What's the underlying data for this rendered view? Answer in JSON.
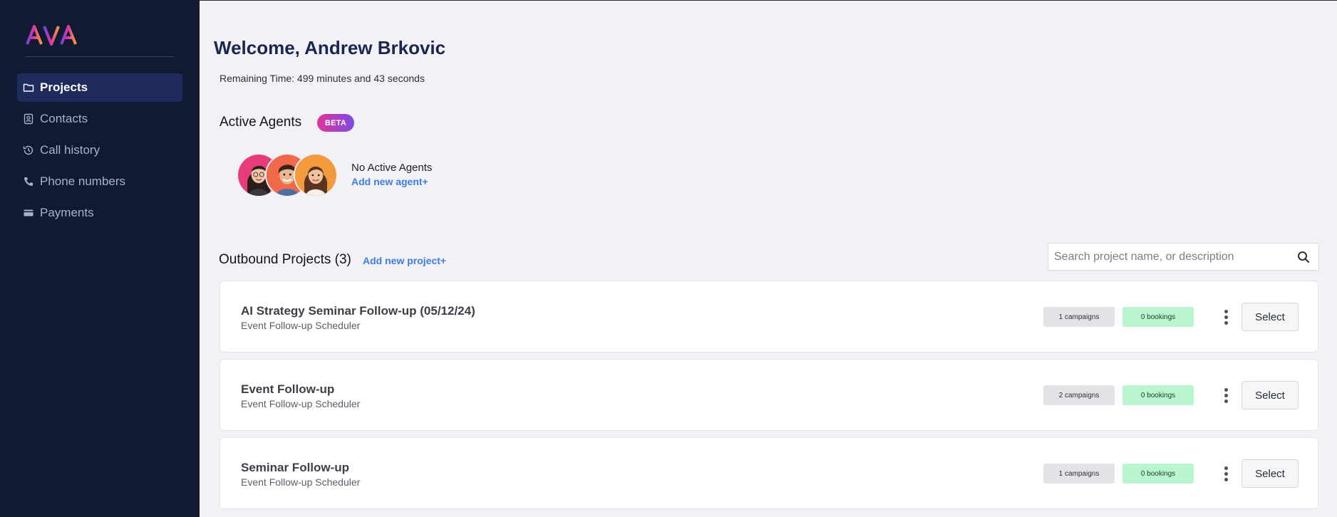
{
  "sidebar": {
    "logo_text": "AVA",
    "items": [
      {
        "label": "Projects",
        "icon": "folder-icon",
        "active": true
      },
      {
        "label": "Contacts",
        "icon": "contact-card-icon",
        "active": false
      },
      {
        "label": "Call history",
        "icon": "history-icon",
        "active": false
      },
      {
        "label": "Phone numbers",
        "icon": "phone-icon",
        "active": false
      },
      {
        "label": "Payments",
        "icon": "credit-card-icon",
        "active": false
      }
    ]
  },
  "header": {
    "welcome": "Welcome, Andrew Brkovic",
    "remaining_time": "Remaining Time: 499 minutes and 43 seconds"
  },
  "agents": {
    "title": "Active Agents",
    "badge": "BETA",
    "status": "No Active Agents",
    "add_link": "Add new agent+"
  },
  "projects": {
    "title": "Outbound Projects (3)",
    "add_link": "Add new project+",
    "search_placeholder": "Search project name, or description",
    "items": [
      {
        "title": "AI Strategy Seminar Follow-up (05/12/24)",
        "subtitle": "Event Follow-up Scheduler",
        "campaigns": "1 campaigns",
        "bookings": "0 bookings",
        "select_label": "Select"
      },
      {
        "title": "Event Follow-up",
        "subtitle": "Event Follow-up Scheduler",
        "campaigns": "2 campaigns",
        "bookings": "0 bookings",
        "select_label": "Select"
      },
      {
        "title": "Seminar Follow-up",
        "subtitle": "Event Follow-up Scheduler",
        "campaigns": "1 campaigns",
        "bookings": "0 bookings",
        "select_label": "Select"
      }
    ]
  },
  "colors": {
    "sidebar_bg": "#111a33",
    "active_nav": "#1f2b5c",
    "link": "#3d7de0",
    "bookings_badge": "#b9f5cf",
    "campaigns_badge": "#e3e3e7"
  }
}
